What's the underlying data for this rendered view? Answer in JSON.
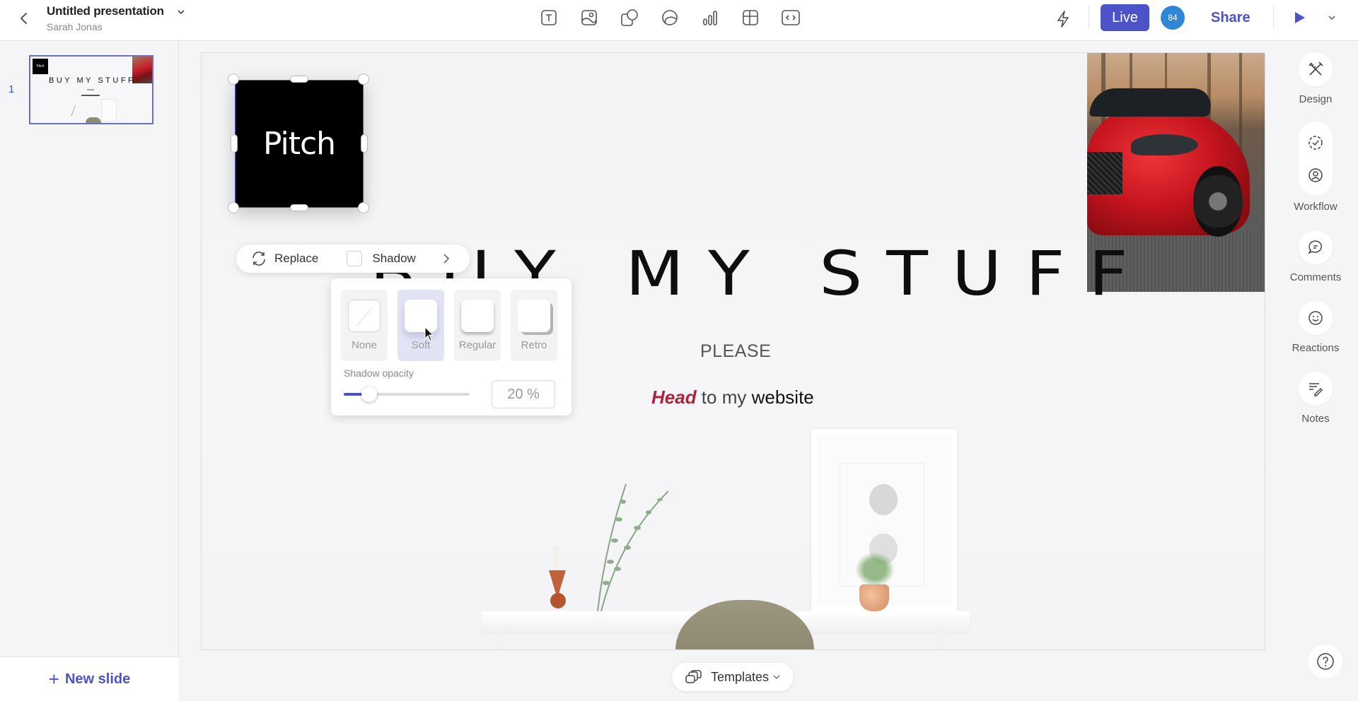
{
  "header": {
    "doc_title": "Untitled presentation",
    "owner": "Sarah Jonas",
    "insert_tools": [
      {
        "name": "text-icon",
        "label": "Text"
      },
      {
        "name": "image-icon",
        "label": "Image"
      },
      {
        "name": "shape-icon",
        "label": "Shape"
      },
      {
        "name": "sticker-icon",
        "label": "Sticker"
      },
      {
        "name": "chart-icon",
        "label": "Chart"
      },
      {
        "name": "table-icon",
        "label": "Table"
      },
      {
        "name": "embed-icon",
        "label": "Embed"
      }
    ],
    "live_label": "Live",
    "avatar_count": "84",
    "share_label": "Share",
    "colors": {
      "accent": "#4c53c9",
      "avatar": "#2f86d6"
    }
  },
  "slides_panel": {
    "slides": [
      {
        "number": "1",
        "thumb_logo": "Pitch",
        "thumb_title": "BUY MY STUFF"
      }
    ],
    "new_slide_label": "New slide"
  },
  "slide": {
    "logo_text": "Pitch",
    "title": "BUY MY STUFF",
    "subtitle": "PLEASE",
    "cta_accent": "Head",
    "cta_middle": " to my ",
    "cta_strong": "website",
    "colors": {
      "accent": "#a8253b"
    }
  },
  "context_toolbar": {
    "replace_label": "Replace",
    "shadow_label": "Shadow",
    "shadow_checked": false
  },
  "shadow_popover": {
    "options": [
      {
        "key": "none",
        "label": "None",
        "selected": false
      },
      {
        "key": "soft",
        "label": "Soft",
        "selected": true
      },
      {
        "key": "regular",
        "label": "Regular",
        "selected": false
      },
      {
        "key": "retro",
        "label": "Retro",
        "selected": false
      }
    ],
    "opacity_label": "Shadow opacity",
    "opacity_value": "20 %",
    "opacity_fraction": 0.2
  },
  "right_rail": {
    "design_label": "Design",
    "workflow_label": "Workflow",
    "comments_label": "Comments",
    "reactions_label": "Reactions",
    "notes_label": "Notes"
  },
  "footer": {
    "templates_label": "Templates"
  }
}
